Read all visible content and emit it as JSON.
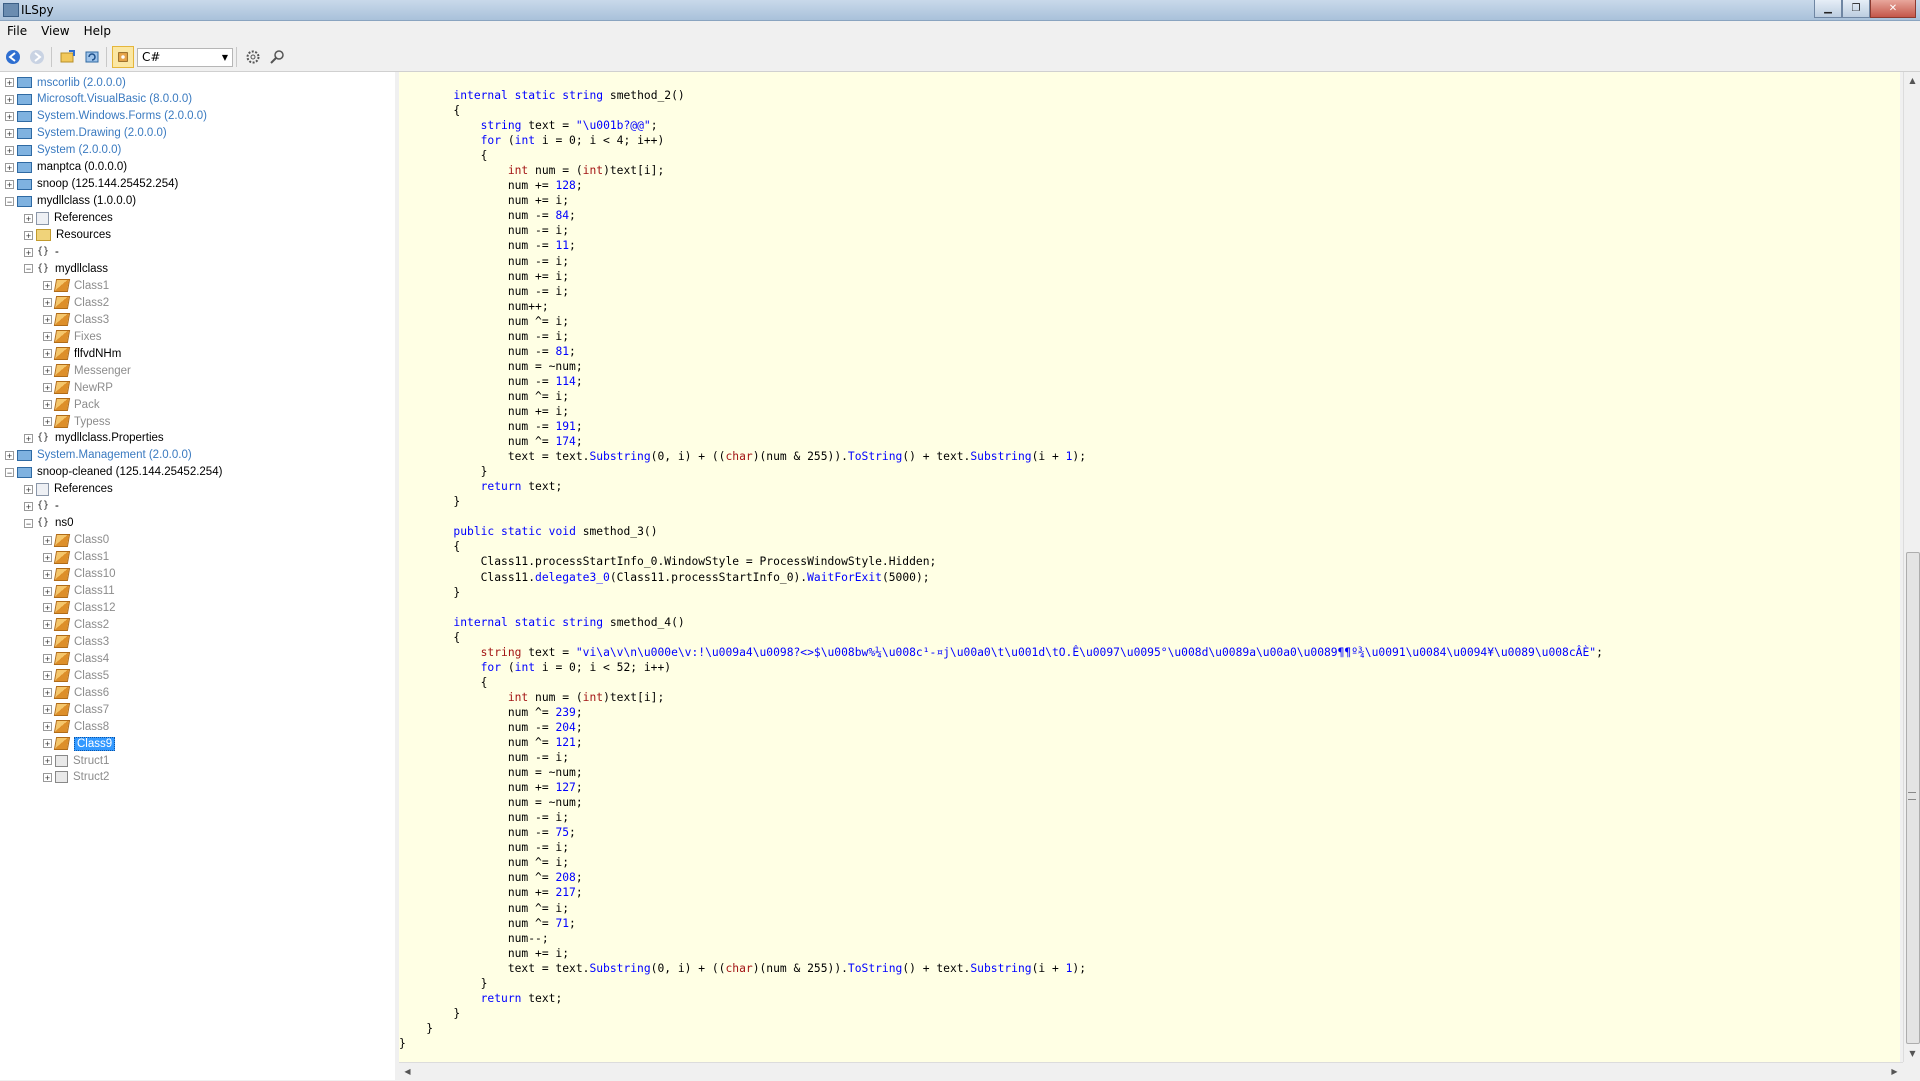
{
  "window": {
    "title": "ILSpy"
  },
  "menu": {
    "file": "File",
    "view": "View",
    "help": "Help"
  },
  "toolbar": {
    "language": "C#"
  },
  "tree": [
    {
      "label": "mscorlib (2.0.0.0)",
      "indent": 0,
      "exp": "+",
      "icon": "asm",
      "color": "blue"
    },
    {
      "label": "Microsoft.VisualBasic (8.0.0.0)",
      "indent": 0,
      "exp": "+",
      "icon": "asm",
      "color": "blue"
    },
    {
      "label": "System.Windows.Forms (2.0.0.0)",
      "indent": 0,
      "exp": "+",
      "icon": "asm",
      "color": "blue"
    },
    {
      "label": "System.Drawing (2.0.0.0)",
      "indent": 0,
      "exp": "+",
      "icon": "asm",
      "color": "blue"
    },
    {
      "label": "System (2.0.0.0)",
      "indent": 0,
      "exp": "+",
      "icon": "asm",
      "color": "blue"
    },
    {
      "label": "manptca (0.0.0.0)",
      "indent": 0,
      "exp": "+",
      "icon": "asm",
      "color": "black"
    },
    {
      "label": "snoop (125.144.25452.254)",
      "indent": 0,
      "exp": "+",
      "icon": "asm",
      "color": "black"
    },
    {
      "label": "mydllclass (1.0.0.0)",
      "indent": 0,
      "exp": "−",
      "icon": "asm",
      "color": "black"
    },
    {
      "label": "References",
      "indent": 1,
      "exp": "+",
      "icon": "ref",
      "color": "black"
    },
    {
      "label": "Resources",
      "indent": 1,
      "exp": "+",
      "icon": "folder",
      "color": "black"
    },
    {
      "label": "-",
      "indent": 1,
      "exp": "+",
      "icon": "ns",
      "color": "black"
    },
    {
      "label": "mydllclass",
      "indent": 1,
      "exp": "−",
      "icon": "ns",
      "color": "black"
    },
    {
      "label": "Class1",
      "indent": 2,
      "exp": "+",
      "icon": "cls",
      "color": "gray"
    },
    {
      "label": "Class2",
      "indent": 2,
      "exp": "+",
      "icon": "cls",
      "color": "gray"
    },
    {
      "label": "Class3",
      "indent": 2,
      "exp": "+",
      "icon": "cls",
      "color": "gray"
    },
    {
      "label": "Fixes",
      "indent": 2,
      "exp": "+",
      "icon": "cls",
      "color": "gray"
    },
    {
      "label": "flfvdNHm",
      "indent": 2,
      "exp": "+",
      "icon": "cls",
      "color": "black"
    },
    {
      "label": "Messenger",
      "indent": 2,
      "exp": "+",
      "icon": "cls",
      "color": "gray"
    },
    {
      "label": "NewRP",
      "indent": 2,
      "exp": "+",
      "icon": "cls",
      "color": "gray"
    },
    {
      "label": "Pack",
      "indent": 2,
      "exp": "+",
      "icon": "cls",
      "color": "gray"
    },
    {
      "label": "Typess",
      "indent": 2,
      "exp": "+",
      "icon": "cls",
      "color": "gray"
    },
    {
      "label": "mydllclass.Properties",
      "indent": 1,
      "exp": "+",
      "icon": "ns",
      "color": "black"
    },
    {
      "label": "System.Management (2.0.0.0)",
      "indent": 0,
      "exp": "+",
      "icon": "asm",
      "color": "blue"
    },
    {
      "label": "snoop-cleaned (125.144.25452.254)",
      "indent": 0,
      "exp": "−",
      "icon": "asm",
      "color": "black"
    },
    {
      "label": "References",
      "indent": 1,
      "exp": "+",
      "icon": "ref",
      "color": "black"
    },
    {
      "label": "-",
      "indent": 1,
      "exp": "+",
      "icon": "ns",
      "color": "black"
    },
    {
      "label": "ns0",
      "indent": 1,
      "exp": "−",
      "icon": "ns",
      "color": "black"
    },
    {
      "label": "Class0",
      "indent": 2,
      "exp": "+",
      "icon": "cls",
      "color": "gray"
    },
    {
      "label": "Class1",
      "indent": 2,
      "exp": "+",
      "icon": "cls",
      "color": "gray"
    },
    {
      "label": "Class10",
      "indent": 2,
      "exp": "+",
      "icon": "cls",
      "color": "gray"
    },
    {
      "label": "Class11",
      "indent": 2,
      "exp": "+",
      "icon": "cls",
      "color": "gray"
    },
    {
      "label": "Class12",
      "indent": 2,
      "exp": "+",
      "icon": "cls",
      "color": "gray"
    },
    {
      "label": "Class2",
      "indent": 2,
      "exp": "+",
      "icon": "cls",
      "color": "gray"
    },
    {
      "label": "Class3",
      "indent": 2,
      "exp": "+",
      "icon": "cls",
      "color": "gray"
    },
    {
      "label": "Class4",
      "indent": 2,
      "exp": "+",
      "icon": "cls",
      "color": "gray"
    },
    {
      "label": "Class5",
      "indent": 2,
      "exp": "+",
      "icon": "cls",
      "color": "gray"
    },
    {
      "label": "Class6",
      "indent": 2,
      "exp": "+",
      "icon": "cls",
      "color": "gray"
    },
    {
      "label": "Class7",
      "indent": 2,
      "exp": "+",
      "icon": "cls",
      "color": "gray"
    },
    {
      "label": "Class8",
      "indent": 2,
      "exp": "+",
      "icon": "cls",
      "color": "gray"
    },
    {
      "label": "Class9",
      "indent": 2,
      "exp": "+",
      "icon": "cls",
      "color": "gray",
      "selected": true
    },
    {
      "label": "Struct1",
      "indent": 2,
      "exp": "+",
      "icon": "struct",
      "color": "gray"
    },
    {
      "label": "Struct2",
      "indent": 2,
      "exp": "+",
      "icon": "struct",
      "color": "gray"
    }
  ],
  "code_lines": [
    [
      [
        "        ",
        ""
      ],
      [
        "internal",
        "kw"
      ],
      [
        " ",
        ""
      ],
      [
        "static",
        "kw"
      ],
      [
        " ",
        ""
      ],
      [
        "string",
        "kw"
      ],
      [
        " smethod_2()",
        ""
      ]
    ],
    [
      [
        "        {",
        ""
      ]
    ],
    [
      [
        "            ",
        ""
      ],
      [
        "string",
        "kw"
      ],
      [
        " text = ",
        ""
      ],
      [
        "\"\\u001b?@@\"",
        "str"
      ],
      [
        ";",
        ""
      ]
    ],
    [
      [
        "            ",
        ""
      ],
      [
        "for",
        "kw"
      ],
      [
        " (",
        ""
      ],
      [
        "int",
        "kw"
      ],
      [
        " i = 0; i < 4; i++)",
        ""
      ]
    ],
    [
      [
        "            {",
        ""
      ]
    ],
    [
      [
        "                ",
        ""
      ],
      [
        "int",
        "ty"
      ],
      [
        " num = (",
        ""
      ],
      [
        "int",
        "ty"
      ],
      [
        ")text[i];",
        ""
      ]
    ],
    [
      [
        "                num += ",
        ""
      ],
      [
        "128",
        "num"
      ],
      [
        ";",
        ""
      ]
    ],
    [
      [
        "                num += i;",
        ""
      ]
    ],
    [
      [
        "                num -= ",
        ""
      ],
      [
        "84",
        "num"
      ],
      [
        ";",
        ""
      ]
    ],
    [
      [
        "                num -= i;",
        ""
      ]
    ],
    [
      [
        "                num -= ",
        ""
      ],
      [
        "11",
        "num"
      ],
      [
        ";",
        ""
      ]
    ],
    [
      [
        "                num -= i;",
        ""
      ]
    ],
    [
      [
        "                num += i;",
        ""
      ]
    ],
    [
      [
        "                num -= i;",
        ""
      ]
    ],
    [
      [
        "                num++;",
        ""
      ]
    ],
    [
      [
        "                num ^= i;",
        ""
      ]
    ],
    [
      [
        "                num -= i;",
        ""
      ]
    ],
    [
      [
        "                num -= ",
        ""
      ],
      [
        "81",
        "num"
      ],
      [
        ";",
        ""
      ]
    ],
    [
      [
        "                num = ~num;",
        ""
      ]
    ],
    [
      [
        "                num -= ",
        ""
      ],
      [
        "114",
        "num"
      ],
      [
        ";",
        ""
      ]
    ],
    [
      [
        "                num ^= i;",
        ""
      ]
    ],
    [
      [
        "                num += i;",
        ""
      ]
    ],
    [
      [
        "                num -= ",
        ""
      ],
      [
        "191",
        "num"
      ],
      [
        ";",
        ""
      ]
    ],
    [
      [
        "                num ^= ",
        ""
      ],
      [
        "174",
        "num"
      ],
      [
        ";",
        ""
      ]
    ],
    [
      [
        "                text = text.",
        ""
      ],
      [
        "Substring",
        "mt"
      ],
      [
        "(0, i) + ((",
        ""
      ],
      [
        "char",
        "ty"
      ],
      [
        ")(num & 255)).",
        ""
      ],
      [
        "ToString",
        "mt"
      ],
      [
        "() + text.",
        ""
      ],
      [
        "Substring",
        "mt"
      ],
      [
        "(i + ",
        ""
      ],
      [
        "1",
        "num"
      ],
      [
        ");",
        ""
      ]
    ],
    [
      [
        "            }",
        ""
      ]
    ],
    [
      [
        "            ",
        ""
      ],
      [
        "return",
        "kw"
      ],
      [
        " text;",
        ""
      ]
    ],
    [
      [
        "        }",
        ""
      ]
    ],
    [
      [
        "",
        ""
      ]
    ],
    [
      [
        "        ",
        ""
      ],
      [
        "public",
        "kw"
      ],
      [
        " ",
        ""
      ],
      [
        "static",
        "kw"
      ],
      [
        " ",
        ""
      ],
      [
        "void",
        "kw"
      ],
      [
        " smethod_3()",
        ""
      ]
    ],
    [
      [
        "        {",
        ""
      ]
    ],
    [
      [
        "            Class11.processStartInfo_0.WindowStyle = ProcessWindowStyle.Hidden;",
        ""
      ]
    ],
    [
      [
        "            Class11.",
        ""
      ],
      [
        "delegate3_0",
        "mt"
      ],
      [
        "(Class11.processStartInfo_0).",
        ""
      ],
      [
        "WaitForExit",
        "mt"
      ],
      [
        "(5000);",
        ""
      ]
    ],
    [
      [
        "        }",
        ""
      ]
    ],
    [
      [
        "",
        ""
      ]
    ],
    [
      [
        "        ",
        ""
      ],
      [
        "internal",
        "kw"
      ],
      [
        " ",
        ""
      ],
      [
        "static",
        "kw"
      ],
      [
        " ",
        ""
      ],
      [
        "string",
        "kw"
      ],
      [
        " smethod_4()",
        ""
      ]
    ],
    [
      [
        "        {",
        ""
      ]
    ],
    [
      [
        "            ",
        ""
      ],
      [
        "string",
        "ty"
      ],
      [
        " text = ",
        ""
      ],
      [
        "\"vi\\a\\v\\n\\u000e\\v:!\\u009a4\\u0098?<>$\\u008bw%¼\\u008c¹-¤j\\u00a0\\t\\u001d\\tO.Ê\\u0097\\u0095°\\u008d\\u0089a\\u00a0\\u0089¶¶º¾\\u0091\\u0084\\u0094¥\\u0089\\u008cÂÈ\"",
        "str"
      ],
      [
        ";",
        ""
      ]
    ],
    [
      [
        "            ",
        ""
      ],
      [
        "for",
        "kw"
      ],
      [
        " (",
        ""
      ],
      [
        "int",
        "kw"
      ],
      [
        " i = 0; i < 52; i++)",
        ""
      ]
    ],
    [
      [
        "            {",
        ""
      ]
    ],
    [
      [
        "                ",
        ""
      ],
      [
        "int",
        "ty"
      ],
      [
        " num = (",
        ""
      ],
      [
        "int",
        "ty"
      ],
      [
        ")text[i];",
        ""
      ]
    ],
    [
      [
        "                num ^= ",
        ""
      ],
      [
        "239",
        "num"
      ],
      [
        ";",
        ""
      ]
    ],
    [
      [
        "                num -= ",
        ""
      ],
      [
        "204",
        "num"
      ],
      [
        ";",
        ""
      ]
    ],
    [
      [
        "                num ^= ",
        ""
      ],
      [
        "121",
        "num"
      ],
      [
        ";",
        ""
      ]
    ],
    [
      [
        "                num -= i;",
        ""
      ]
    ],
    [
      [
        "                num = ~num;",
        ""
      ]
    ],
    [
      [
        "                num += ",
        ""
      ],
      [
        "127",
        "num"
      ],
      [
        ";",
        ""
      ]
    ],
    [
      [
        "                num = ~num;",
        ""
      ]
    ],
    [
      [
        "                num -= i;",
        ""
      ]
    ],
    [
      [
        "                num -= ",
        ""
      ],
      [
        "75",
        "num"
      ],
      [
        ";",
        ""
      ]
    ],
    [
      [
        "                num -= i;",
        ""
      ]
    ],
    [
      [
        "                num ^= i;",
        ""
      ]
    ],
    [
      [
        "                num ^= ",
        ""
      ],
      [
        "208",
        "num"
      ],
      [
        ";",
        ""
      ]
    ],
    [
      [
        "                num += ",
        ""
      ],
      [
        "217",
        "num"
      ],
      [
        ";",
        ""
      ]
    ],
    [
      [
        "                num ^= i;",
        ""
      ]
    ],
    [
      [
        "                num ^= ",
        ""
      ],
      [
        "71",
        "num"
      ],
      [
        ";",
        ""
      ]
    ],
    [
      [
        "                num--;",
        ""
      ]
    ],
    [
      [
        "                num += i;",
        ""
      ]
    ],
    [
      [
        "                text = text.",
        ""
      ],
      [
        "Substring",
        "mt"
      ],
      [
        "(0, i) + ((",
        ""
      ],
      [
        "char",
        "ty"
      ],
      [
        ")(num & 255)).",
        ""
      ],
      [
        "ToString",
        "mt"
      ],
      [
        "() + text.",
        ""
      ],
      [
        "Substring",
        "mt"
      ],
      [
        "(i + ",
        ""
      ],
      [
        "1",
        "num"
      ],
      [
        ");",
        ""
      ]
    ],
    [
      [
        "            }",
        ""
      ]
    ],
    [
      [
        "            ",
        ""
      ],
      [
        "return",
        "kw"
      ],
      [
        " text;",
        ""
      ]
    ],
    [
      [
        "        }",
        ""
      ]
    ],
    [
      [
        "    }",
        ""
      ]
    ],
    [
      [
        "}",
        ""
      ]
    ]
  ]
}
